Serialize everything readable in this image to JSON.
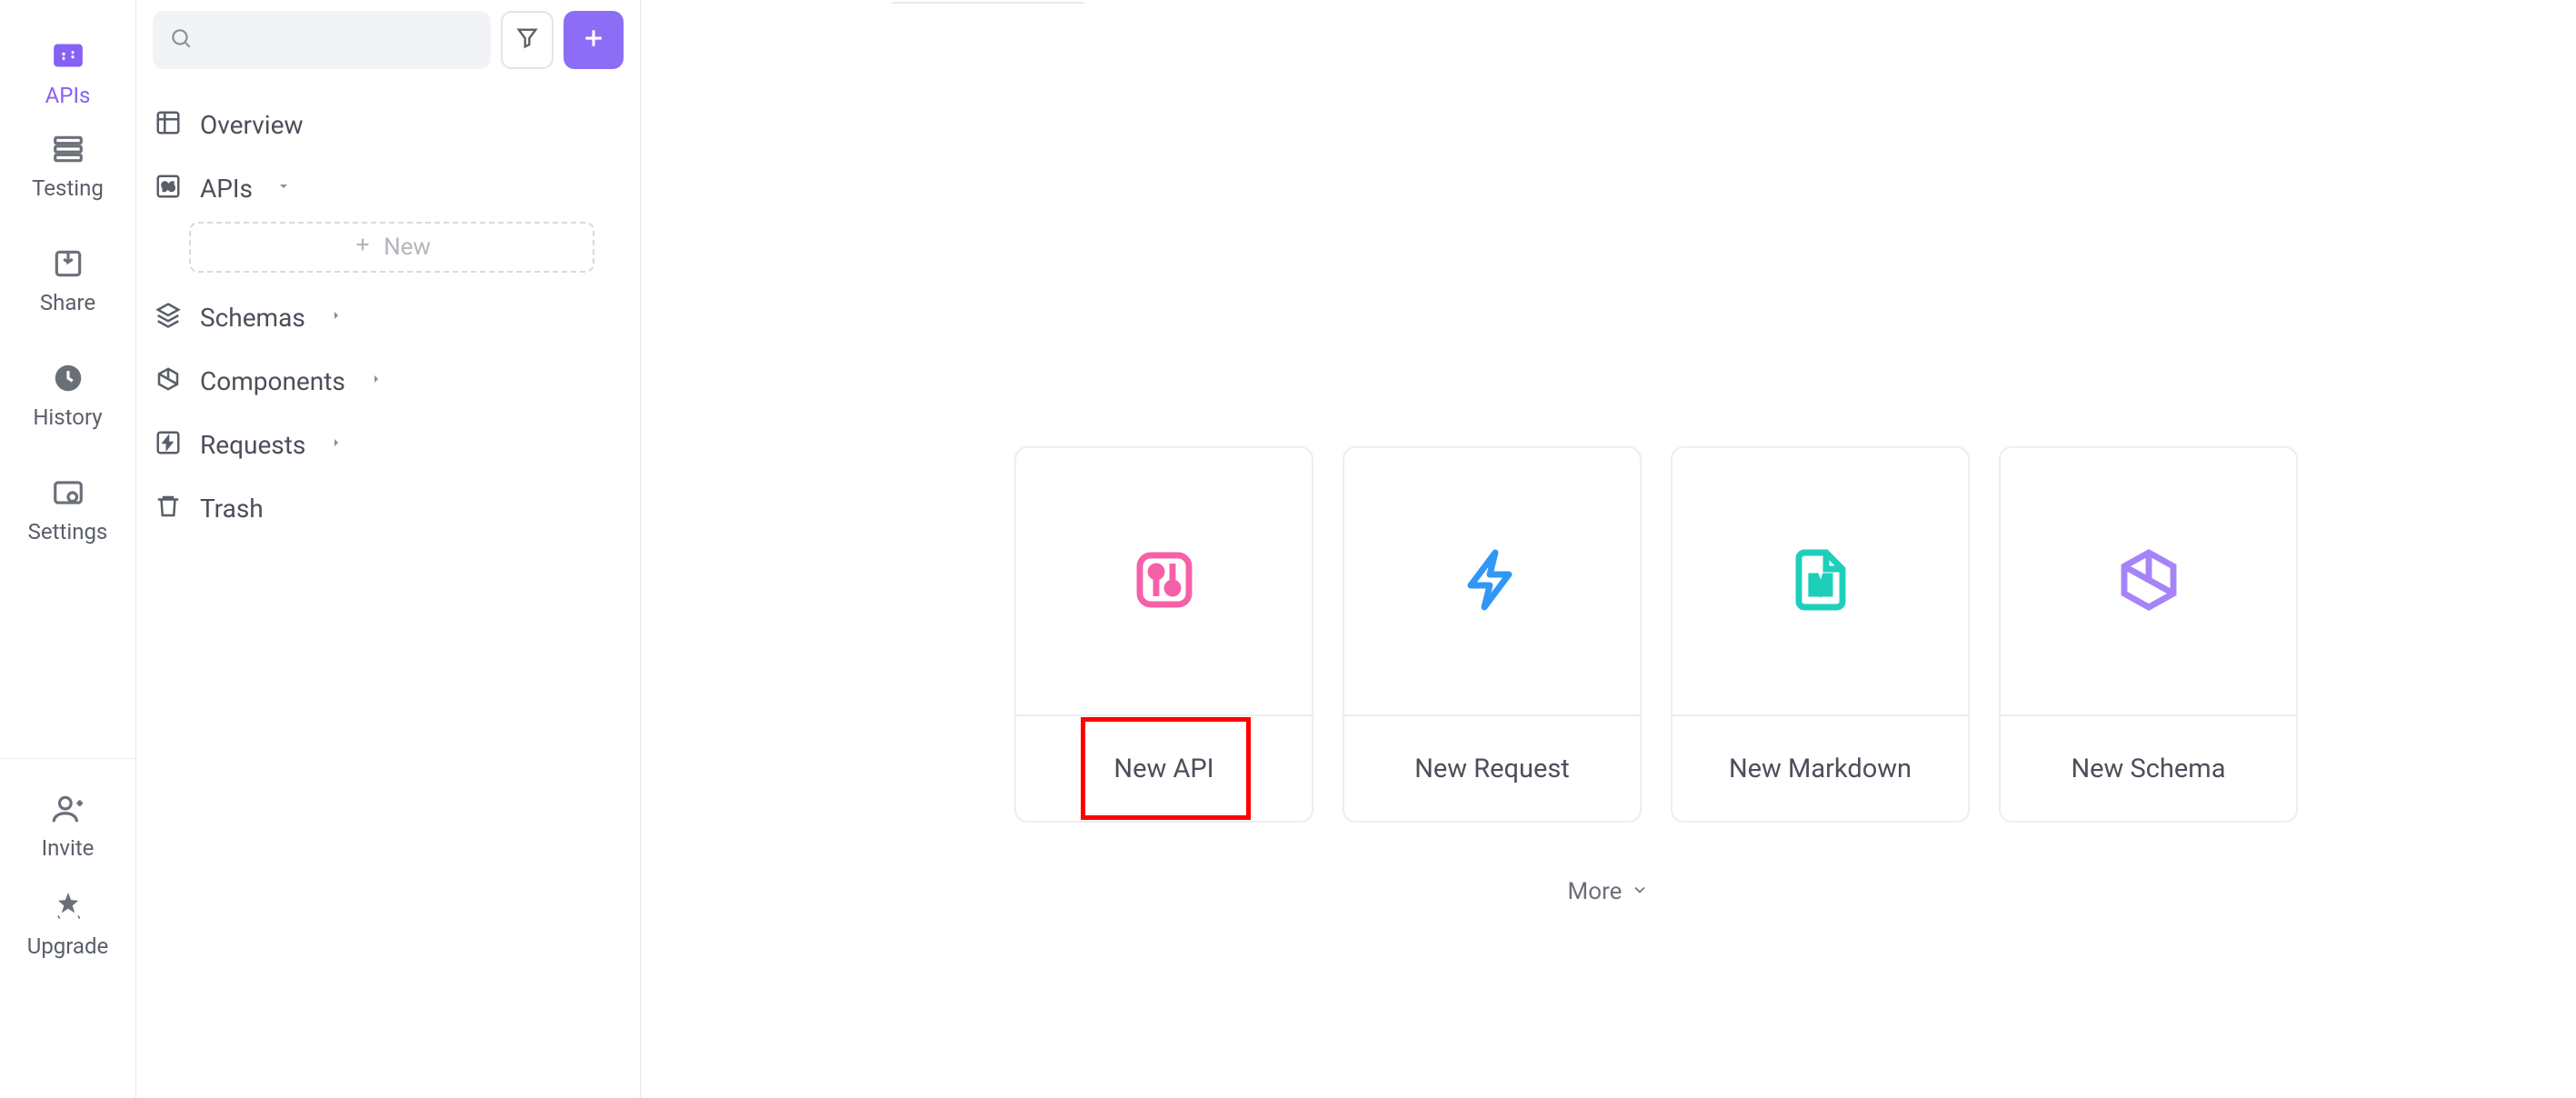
{
  "nav_rail": {
    "items": [
      {
        "label": "APIs"
      },
      {
        "label": "Testing"
      },
      {
        "label": "Share"
      },
      {
        "label": "History"
      },
      {
        "label": "Settings"
      }
    ],
    "footer": [
      {
        "label": "Invite"
      },
      {
        "label": "Upgrade"
      }
    ]
  },
  "sidebar": {
    "tree": {
      "overview": "Overview",
      "apis": "APIs",
      "new_btn": "New",
      "schemas": "Schemas",
      "components": "Components",
      "requests": "Requests",
      "trash": "Trash"
    }
  },
  "main": {
    "cards": [
      {
        "label": "New API"
      },
      {
        "label": "New Request"
      },
      {
        "label": "New Markdown"
      },
      {
        "label": "New Schema"
      }
    ],
    "more": "More"
  },
  "colors": {
    "accent": "#8661f5",
    "api_icon": "#f561a8",
    "request_icon": "#3197f5",
    "markdown_icon": "#1dcfbb",
    "schema_icon": "#a584f9"
  }
}
